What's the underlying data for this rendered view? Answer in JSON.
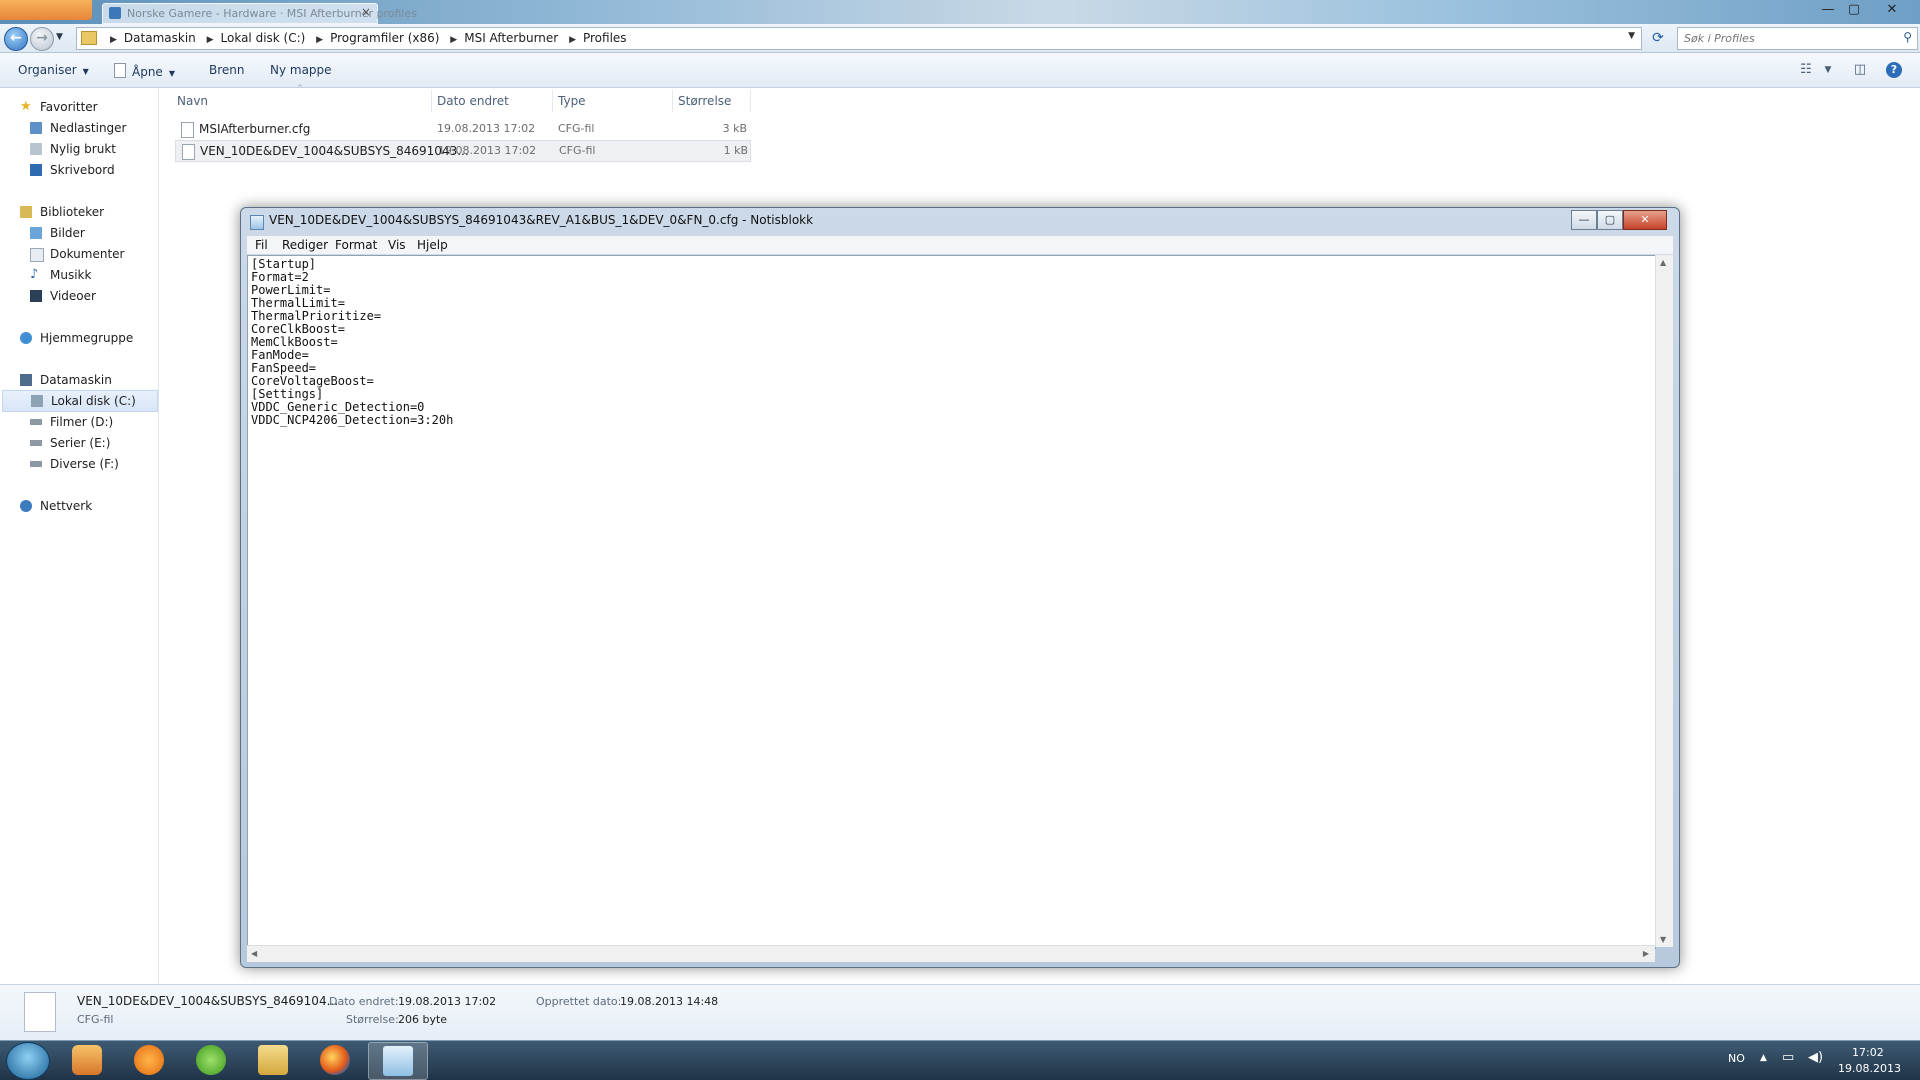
{
  "browser_tab": {
    "text": "Norske Gamere - Hardware · MSI Afterburner profiles"
  },
  "window_buttons": {
    "minimize": "—",
    "maximize": "▢",
    "close": "✕"
  },
  "address": {
    "crumbs": [
      "Datamaskin",
      "Lokal disk (C:)",
      "Programfiler (x86)",
      "MSI Afterburner",
      "Profiles"
    ],
    "search_placeholder": "Søk i Profiles"
  },
  "toolbar": {
    "organize": "Organiser",
    "open": "Åpne",
    "burn": "Brenn",
    "new_folder": "Ny mappe"
  },
  "nav": {
    "favorites": "Favoritter",
    "favorites_items": [
      "Nedlastinger",
      "Nylig brukt",
      "Skrivebord"
    ],
    "libraries": "Biblioteker",
    "libraries_items": [
      "Bilder",
      "Dokumenter",
      "Musikk",
      "Videoer"
    ],
    "homegroup": "Hjemmegruppe",
    "computer": "Datamaskin",
    "computer_items": [
      "Lokal disk (C:)",
      "Filmer  (D:)",
      "Serier (E:)",
      "Diverse (F:)"
    ],
    "network": "Nettverk"
  },
  "columns": {
    "name": "Navn",
    "date": "Dato endret",
    "type": "Type",
    "size": "Størrelse"
  },
  "files": [
    {
      "name": "MSIAfterburner.cfg",
      "date": "19.08.2013 17:02",
      "type": "CFG-fil",
      "size": "3 kB"
    },
    {
      "name": "VEN_10DE&DEV_1004&SUBSYS_84691043...",
      "date": "19.08.2013 17:02",
      "type": "CFG-fil",
      "size": "1 kB"
    }
  ],
  "notepad": {
    "title": "VEN_10DE&DEV_1004&SUBSYS_84691043&REV_A1&BUS_1&DEV_0&FN_0.cfg - Notisblokk",
    "menu": [
      "Fil",
      "Rediger",
      "Format",
      "Vis",
      "Hjelp"
    ],
    "content": "[Startup]\nFormat=2\nPowerLimit=\nThermalLimit=\nThermalPrioritize=\nCoreClkBoost=\nMemClkBoost=\nFanMode=\nFanSpeed=\nCoreVoltageBoost=\n[Settings]\nVDDC_Generic_Detection=0\nVDDC_NCP4206_Detection=3:20h"
  },
  "details": {
    "filename": "VEN_10DE&DEV_1004&SUBSYS_8469104...",
    "filetype": "CFG-fil",
    "modified_label": "Dato endret:",
    "modified_value": "19.08.2013 17:02",
    "size_label": "Størrelse:",
    "size_value": "206 byte",
    "created_label": "Opprettet dato:",
    "created_value": "19.08.2013 14:48"
  },
  "tray": {
    "lang": "NO",
    "time": "17:02",
    "date": "19.08.2013"
  }
}
